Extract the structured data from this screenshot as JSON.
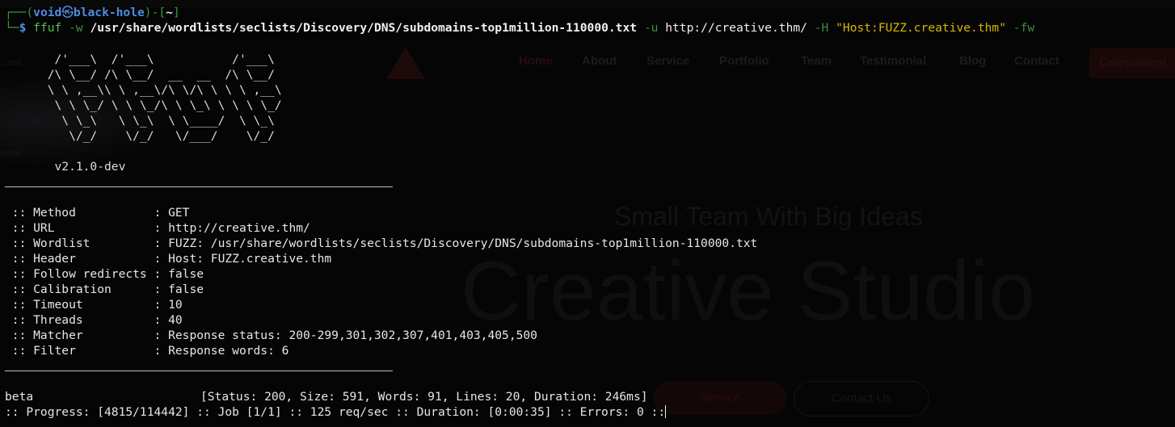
{
  "background_site": {
    "nav": [
      "Home",
      "About",
      "Service",
      "Portfolio",
      "Team",
      "Testimonial",
      "Blog",
      "Contact"
    ],
    "nav_button": "Component",
    "side_text_1": "...ros",
    "side_text_2": "veira",
    "tagline": "Small Team With Big Ideas",
    "hero": "Creative Studio",
    "buttons": [
      "Service",
      "Contact Us"
    ]
  },
  "prompt": {
    "frame_top": "┌──(",
    "user": "void",
    "skull": "㉿",
    "host": "black-hole",
    "sep": ")-[",
    "cwd": "~",
    "close": "]",
    "frame_bottom": "└─",
    "symbol": "$"
  },
  "command": {
    "binary": "ffuf",
    "flag_w": "-w",
    "wordlist": "/usr/share/wordlists/seclists/Discovery/DNS/subdomains-top1million-110000.txt",
    "flag_u": "-u",
    "url": "http://creative.thm/",
    "flag_H": "-H",
    "header": "\"Host:FUZZ.creative.thm\"",
    "flag_fw": "-fw"
  },
  "banner": [
    "       /'___\\  /'___\\           /'___\\",
    "      /\\ \\__/ /\\ \\__/  __  __  /\\ \\__/",
    "      \\ \\ ,__\\\\ \\ ,__\\/\\ \\/\\ \\ \\ \\ ,__\\",
    "       \\ \\ \\_/ \\ \\ \\_/\\ \\ \\_\\ \\ \\ \\ \\_/",
    "        \\ \\_\\   \\ \\_\\  \\ \\____/  \\ \\_\\",
    "         \\/_/    \\/_/   \\/___/    \\/_/"
  ],
  "version": "       v2.1.0-dev",
  "settings": [
    {
      "key": " :: Method           ",
      "value": ": GET"
    },
    {
      "key": " :: URL              ",
      "value": ": http://creative.thm/"
    },
    {
      "key": " :: Wordlist         ",
      "value": ": FUZZ: /usr/share/wordlists/seclists/Discovery/DNS/subdomains-top1million-110000.txt"
    },
    {
      "key": " :: Header           ",
      "value": ": Host: FUZZ.creative.thm"
    },
    {
      "key": " :: Follow redirects ",
      "value": ": false"
    },
    {
      "key": " :: Calibration      ",
      "value": ": false"
    },
    {
      "key": " :: Timeout          ",
      "value": ": 10"
    },
    {
      "key": " :: Threads          ",
      "value": ": 40"
    },
    {
      "key": " :: Matcher          ",
      "value": ": Response status: 200-299,301,302,307,401,403,405,500"
    },
    {
      "key": " :: Filter           ",
      "value": ": Response words: 6"
    }
  ],
  "result": {
    "name": "beta",
    "details": "[Status: 200, Size: 591, Words: 91, Lines: 20, Duration: 246ms]"
  },
  "progress": ":: Progress: [4815/114442] :: Job [1/1] :: 125 req/sec :: Duration: [0:00:35] :: Errors: 0 ::"
}
